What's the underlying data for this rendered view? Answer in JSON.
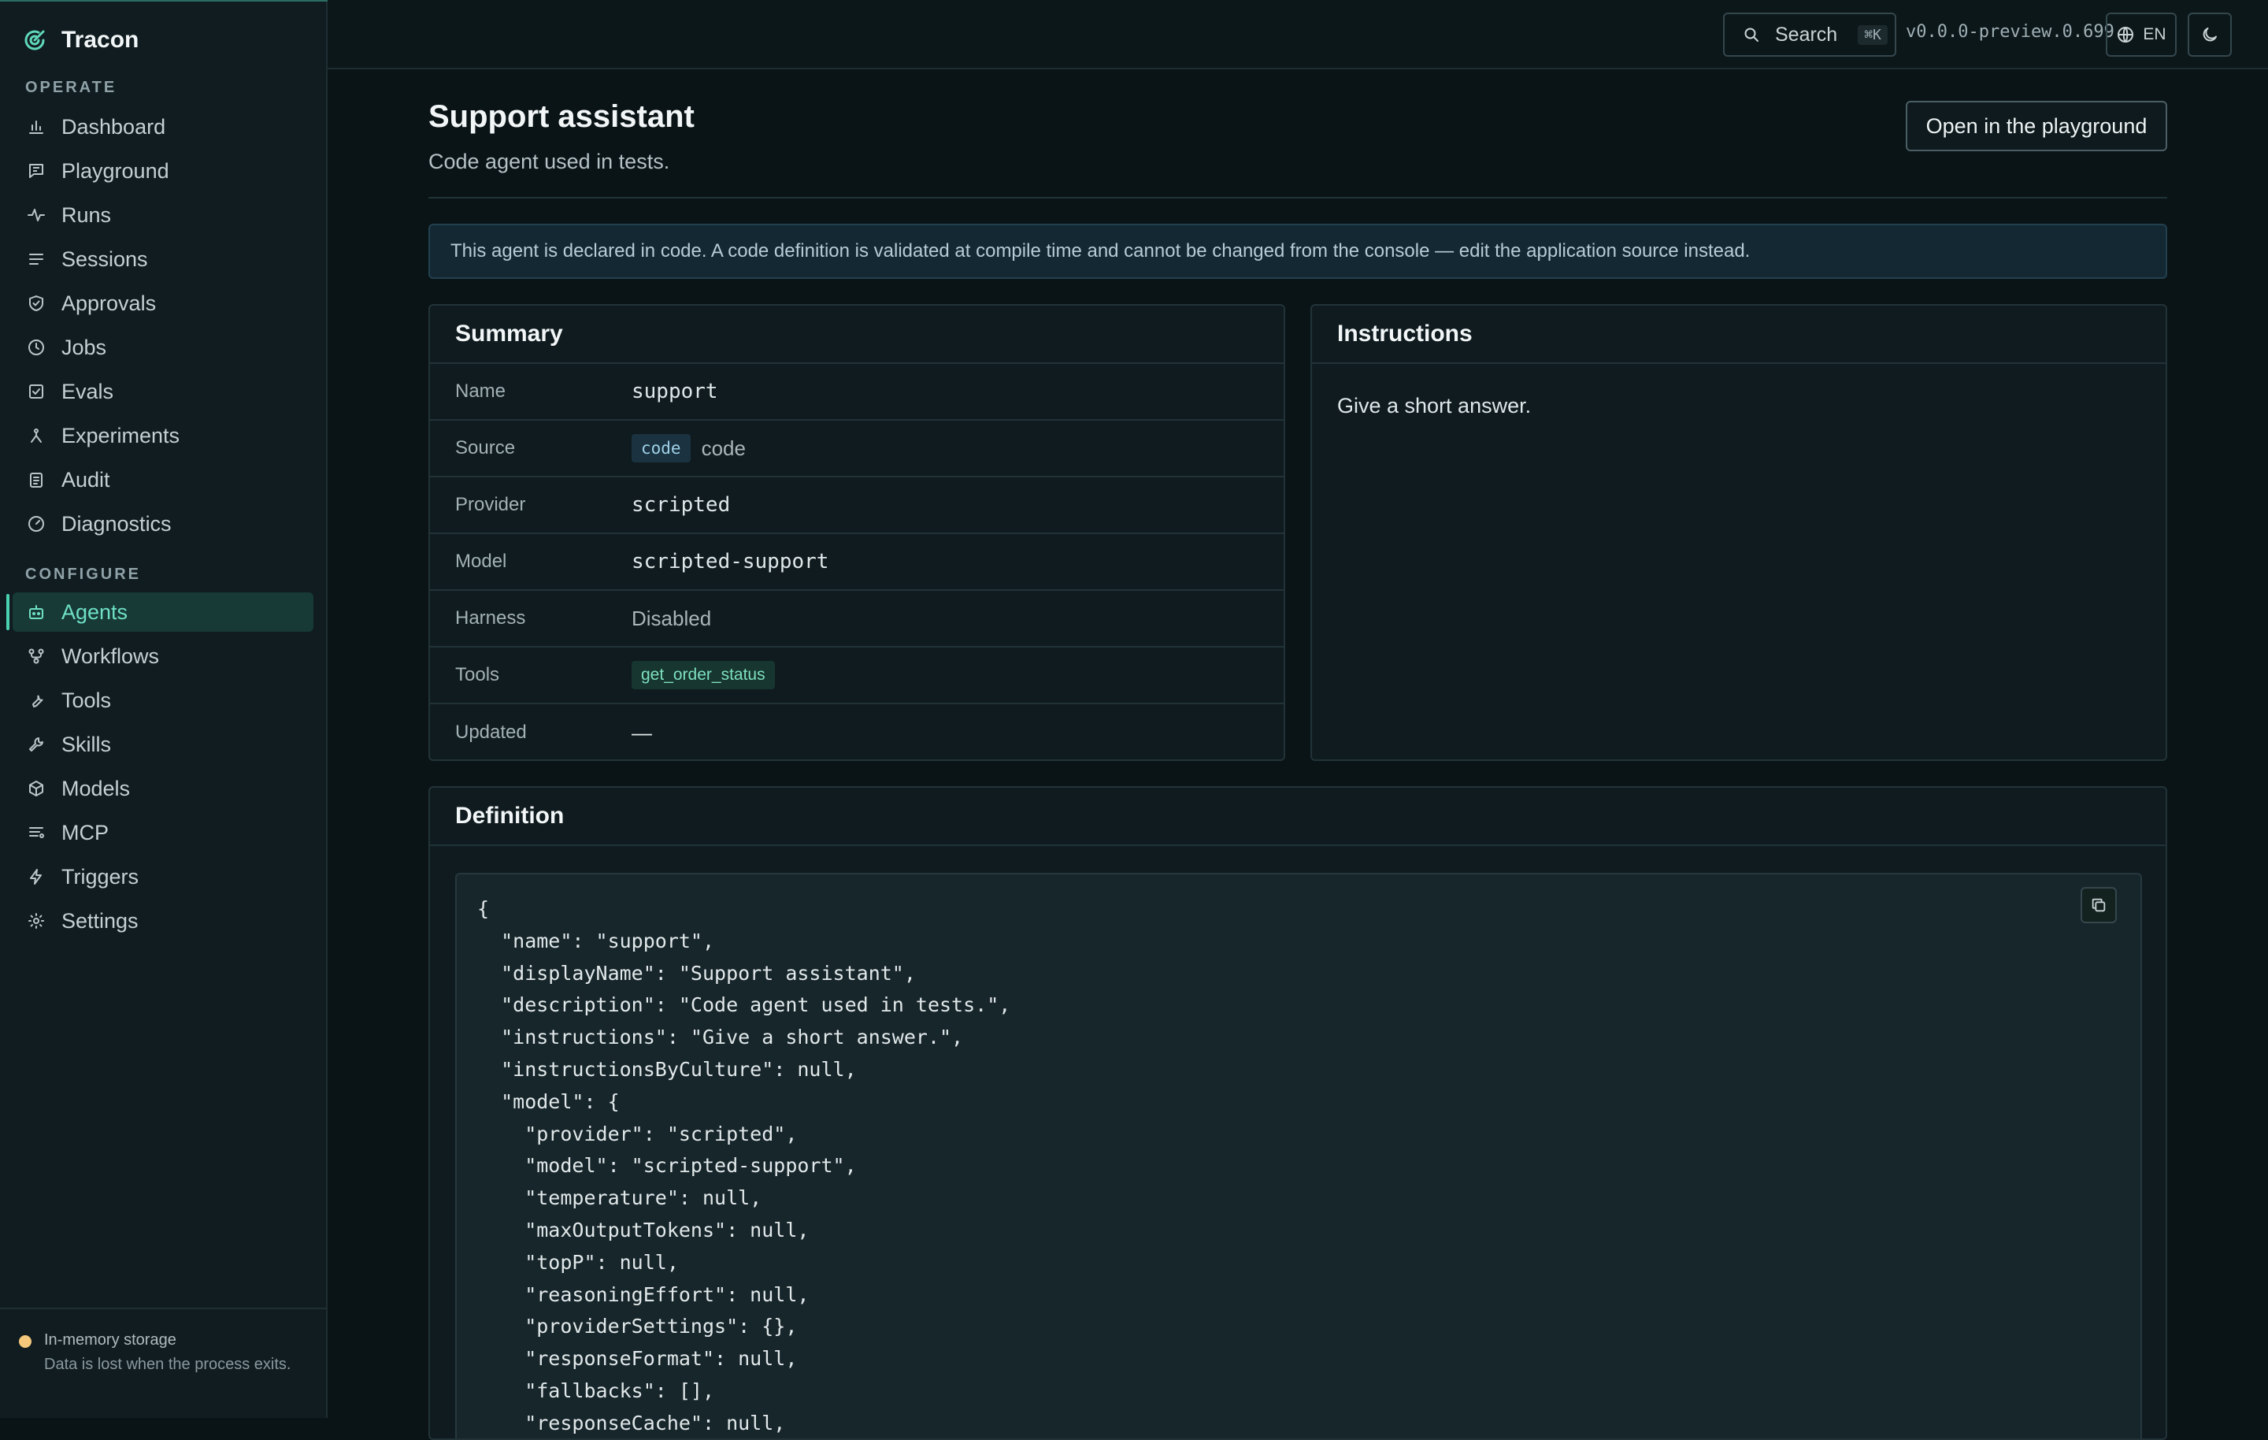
{
  "app": {
    "name": "Tracon"
  },
  "sidebar": {
    "operate_label": "OPERATE",
    "configure_label": "CONFIGURE",
    "operate_items": [
      {
        "label": "Dashboard",
        "icon": "bar-chart-icon"
      },
      {
        "label": "Playground",
        "icon": "message-square-icon"
      },
      {
        "label": "Runs",
        "icon": "activity-icon"
      },
      {
        "label": "Sessions",
        "icon": "list-icon"
      },
      {
        "label": "Approvals",
        "icon": "shield-check-icon"
      },
      {
        "label": "Jobs",
        "icon": "clock-icon"
      },
      {
        "label": "Evals",
        "icon": "check-square-icon"
      },
      {
        "label": "Experiments",
        "icon": "branch-icon"
      },
      {
        "label": "Audit",
        "icon": "clipboard-icon"
      },
      {
        "label": "Diagnostics",
        "icon": "gauge-icon"
      }
    ],
    "configure_items": [
      {
        "label": "Agents",
        "icon": "bot-icon",
        "active": true
      },
      {
        "label": "Workflows",
        "icon": "workflow-icon"
      },
      {
        "label": "Tools",
        "icon": "wrench-icon"
      },
      {
        "label": "Skills",
        "icon": "wrench-alt-icon"
      },
      {
        "label": "Models",
        "icon": "box-icon"
      },
      {
        "label": "MCP",
        "icon": "server-list-icon"
      },
      {
        "label": "Triggers",
        "icon": "zap-icon"
      },
      {
        "label": "Settings",
        "icon": "sun-gear-icon"
      }
    ],
    "footer": {
      "title": "In-memory storage",
      "note": "Data is lost when the process exits."
    }
  },
  "topbar": {
    "search_label": "Search",
    "search_shortcut": "⌘K",
    "version": "v0.0.0-preview.0.699",
    "language": "EN"
  },
  "page": {
    "title": "Support assistant",
    "description": "Code agent used in tests.",
    "open_playground_label": "Open in the playground",
    "notice": "This agent is declared in code. A code definition is validated at compile time and cannot be changed from the console — edit the application source instead."
  },
  "summary": {
    "title": "Summary",
    "rows": {
      "name": {
        "label": "Name",
        "value": "support"
      },
      "source": {
        "label": "Source",
        "badge": "code",
        "value": "code"
      },
      "provider": {
        "label": "Provider",
        "value": "scripted"
      },
      "model": {
        "label": "Model",
        "value": "scripted-support"
      },
      "harness": {
        "label": "Harness",
        "value": "Disabled"
      },
      "tools": {
        "label": "Tools",
        "value": "get_order_status"
      },
      "updated": {
        "label": "Updated",
        "value": "—"
      }
    }
  },
  "instructions": {
    "title": "Instructions",
    "text": "Give a short answer."
  },
  "definition": {
    "title": "Definition",
    "code": "{\n  \"name\": \"support\",\n  \"displayName\": \"Support assistant\",\n  \"description\": \"Code agent used in tests.\",\n  \"instructions\": \"Give a short answer.\",\n  \"instructionsByCulture\": null,\n  \"model\": {\n    \"provider\": \"scripted\",\n    \"model\": \"scripted-support\",\n    \"temperature\": null,\n    \"maxOutputTokens\": null,\n    \"topP\": null,\n    \"reasoningEffort\": null,\n    \"providerSettings\": {},\n    \"responseFormat\": null,\n    \"fallbacks\": [],\n    \"responseCache\": null,"
  },
  "colors": {
    "accent": "#4ad1b0",
    "background": "#0a1417",
    "sidebar": "#101c20",
    "storage_warning": "#f5c77a"
  }
}
